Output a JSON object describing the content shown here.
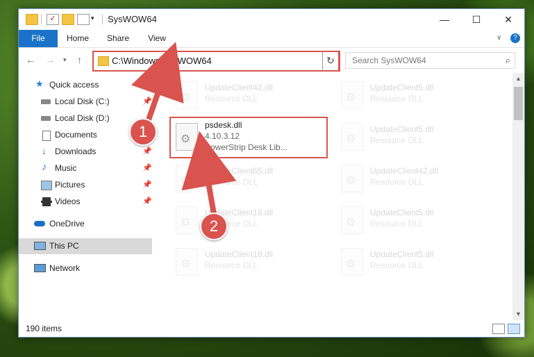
{
  "window": {
    "title": "SysWOW64",
    "controls": {
      "minimize": "—",
      "maximize": "☐",
      "close": "✕"
    },
    "help": "?"
  },
  "ribbon": {
    "tabs": [
      "File",
      "Home",
      "Share",
      "View"
    ]
  },
  "address": {
    "path": "C:\\Windows\\SysWOW64",
    "search_placeholder": "Search SysWOW64"
  },
  "sidebar": {
    "items": [
      {
        "label": "Quick access",
        "icon": "star-icon",
        "pinned": false
      },
      {
        "label": "Local Disk (C:)",
        "icon": "drive-icon",
        "pinned": true
      },
      {
        "label": "Local Disk (D:)",
        "icon": "drive-icon",
        "pinned": false
      },
      {
        "label": "Documents",
        "icon": "documents-icon",
        "pinned": true
      },
      {
        "label": "Downloads",
        "icon": "download-arrow-icon",
        "pinned": true
      },
      {
        "label": "Music",
        "icon": "music-note-icon",
        "pinned": true
      },
      {
        "label": "Pictures",
        "icon": "pictures-icon",
        "pinned": true
      },
      {
        "label": "Videos",
        "icon": "film-icon",
        "pinned": true
      },
      {
        "label": "OneDrive",
        "icon": "cloud-icon",
        "pinned": false
      },
      {
        "label": "This PC",
        "icon": "computer-icon",
        "pinned": false,
        "selected": true
      },
      {
        "label": "Network",
        "icon": "network-icon",
        "pinned": false
      }
    ]
  },
  "files": [
    {
      "name": "UpdateClient42.dll",
      "type": "Resource DLL"
    },
    {
      "name": "UpdateClient5.dll",
      "type": "Resource DLL"
    },
    {
      "name": "psdesk.dll",
      "version": "4.10.3.12",
      "desc": "PowerStrip Desk Lib..."
    },
    {
      "name": "UpdateClient5.dll",
      "type": "Resource DLL"
    },
    {
      "name": "UpdateClient65.dll",
      "type": "Resource DLL"
    },
    {
      "name": "UpdateClient42.dll",
      "type": "Resource DLL"
    },
    {
      "name": "UpdateClient19.dll",
      "type": "Resource DLL"
    },
    {
      "name": "UpdateClient5.dll",
      "type": "Resource DLL"
    },
    {
      "name": "UpdateClient19.dll",
      "type": "Resource DLL"
    },
    {
      "name": "UpdateClient5.dll",
      "type": "Resource DLL"
    }
  ],
  "status": {
    "item_count": "190 items"
  },
  "callouts": [
    "1",
    "2"
  ],
  "colors": {
    "accent": "#1a73c8",
    "highlight": "#d9534f"
  }
}
